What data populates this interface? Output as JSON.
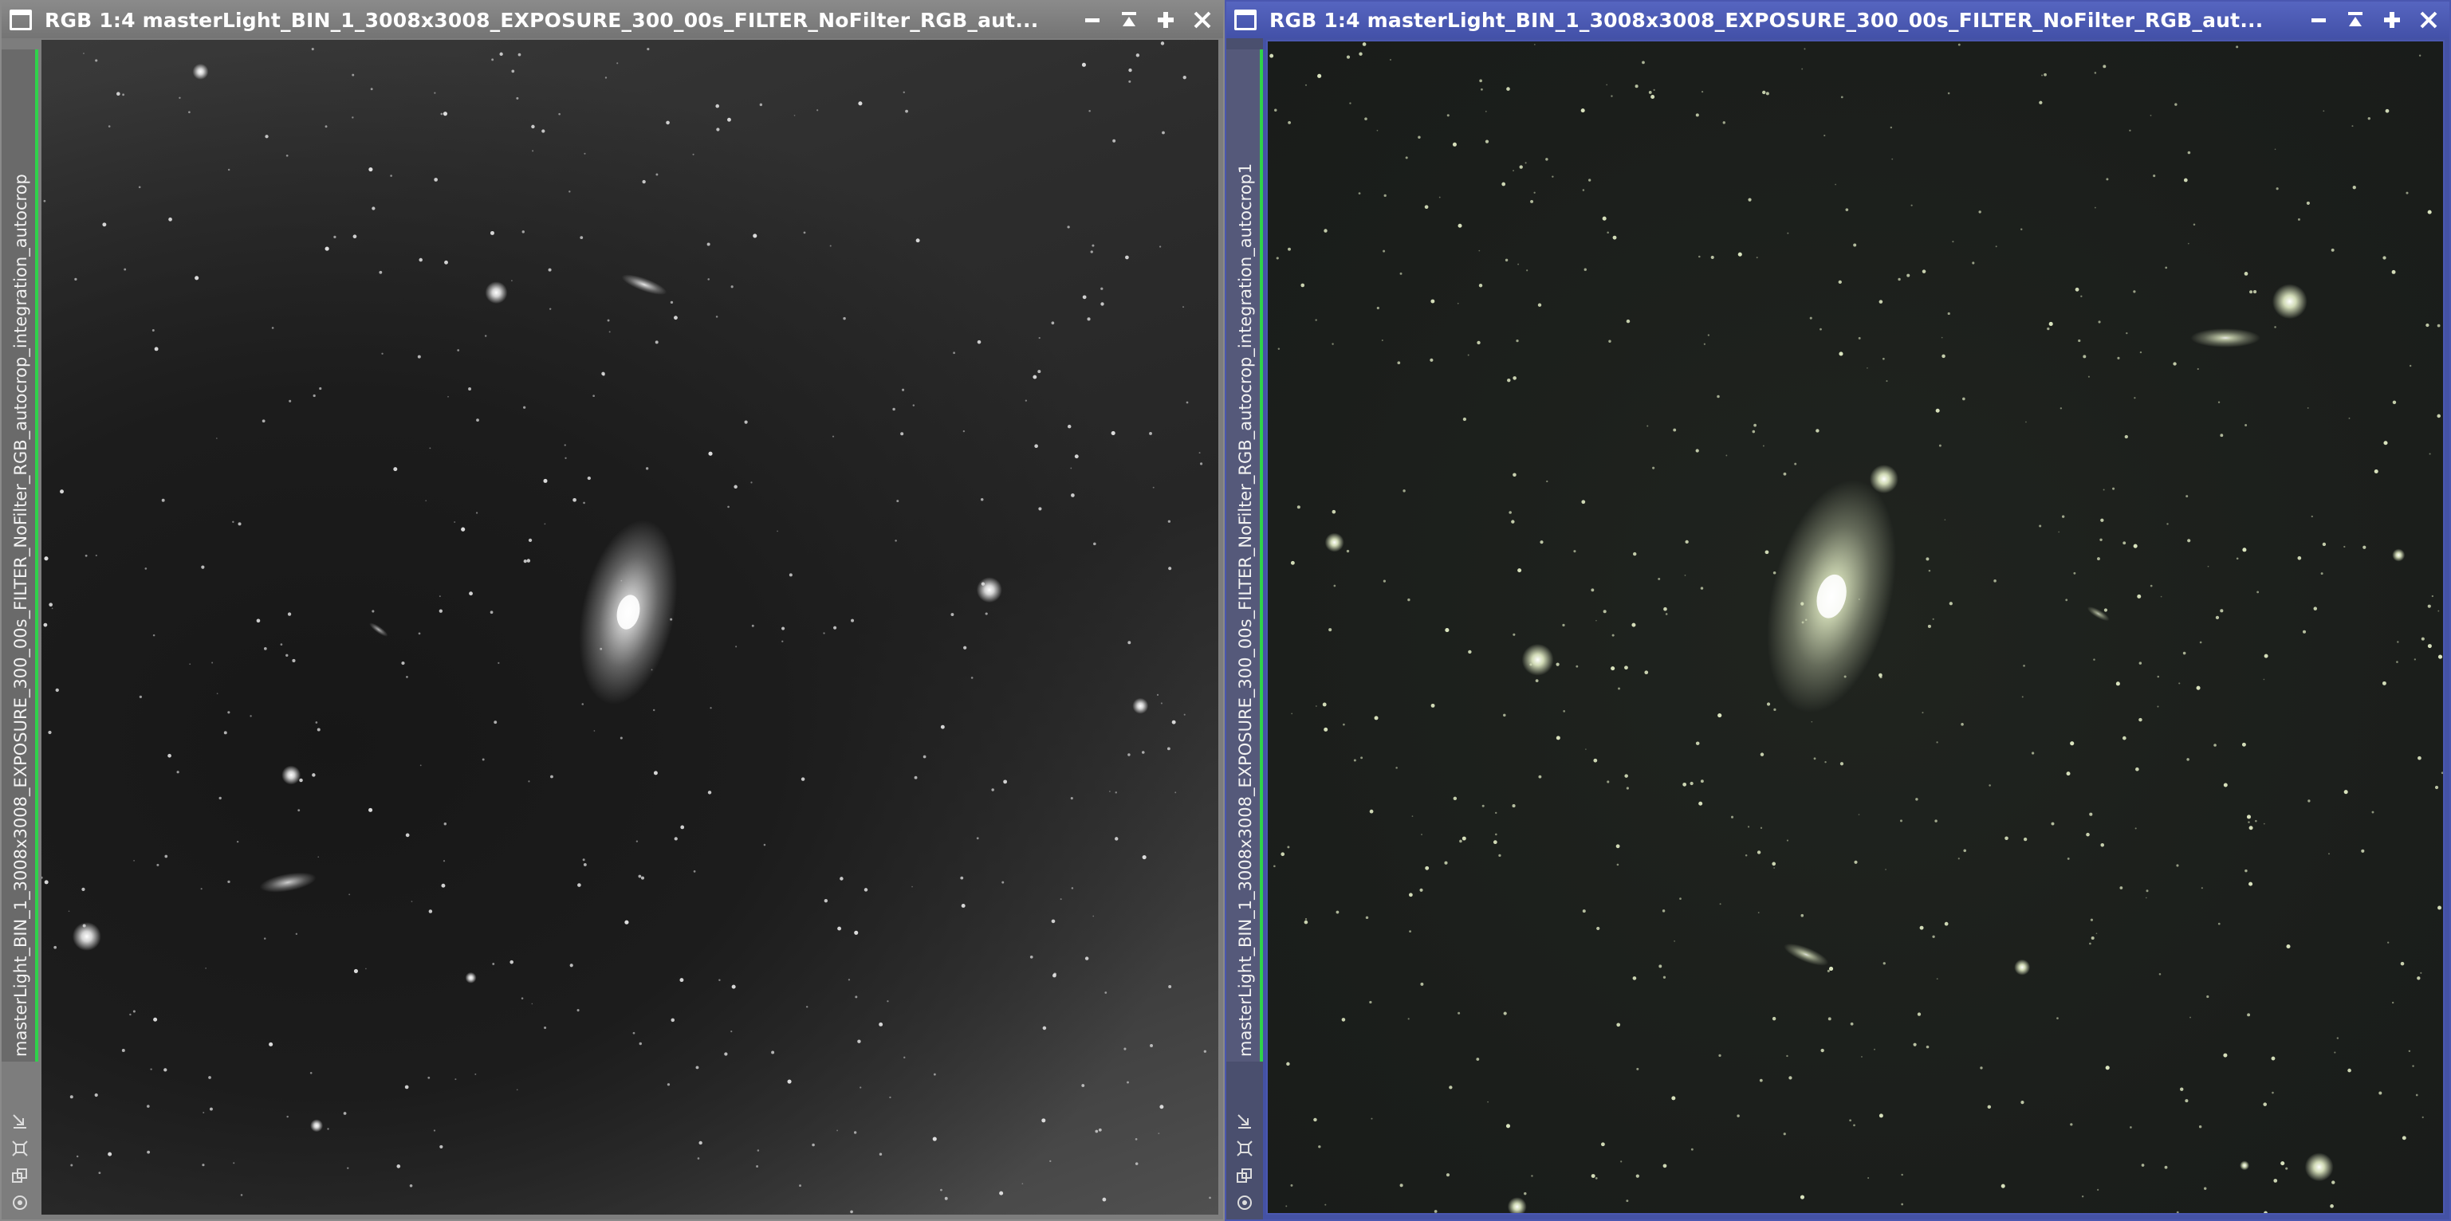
{
  "windows": [
    {
      "id": "left",
      "title": "RGB 1:4 masterLight_BIN_1_3008x3008_EXPOSURE_300_00s_FILTER_NoFilter_RGB_aut...",
      "image_id": "masterLight_BIN_1_3008x3008_EXPOSURE_300_00s_FILTER_NoFilter_RGB_autocrop_integration_autocrop",
      "active": false,
      "title_bg": "#7d7d7d"
    },
    {
      "id": "right",
      "title": "RGB 1:4 masterLight_BIN_1_3008x3008_EXPOSURE_300_00s_FILTER_NoFilter_RGB_aut...",
      "image_id": "masterLight_BIN_1_3008x3008_EXPOSURE_300_00s_FILTER_NoFilter_RGB_autocrop_integration_autocrop1",
      "active": true,
      "title_bg": "#4452a5"
    }
  ],
  "icons": {
    "window": "window-icon",
    "minimize": "minimize-icon",
    "shade": "shade-icon",
    "maximize": "maximize-icon",
    "close": "close-icon",
    "shrink": "shrink-icon",
    "fit": "fit-view-icon",
    "clone": "clone-icon",
    "target": "target-icon"
  },
  "colors": {
    "accent_active": "#4452a5",
    "accent_inactive": "#7d7d7d",
    "image_id_bar": "#2fd24a"
  }
}
